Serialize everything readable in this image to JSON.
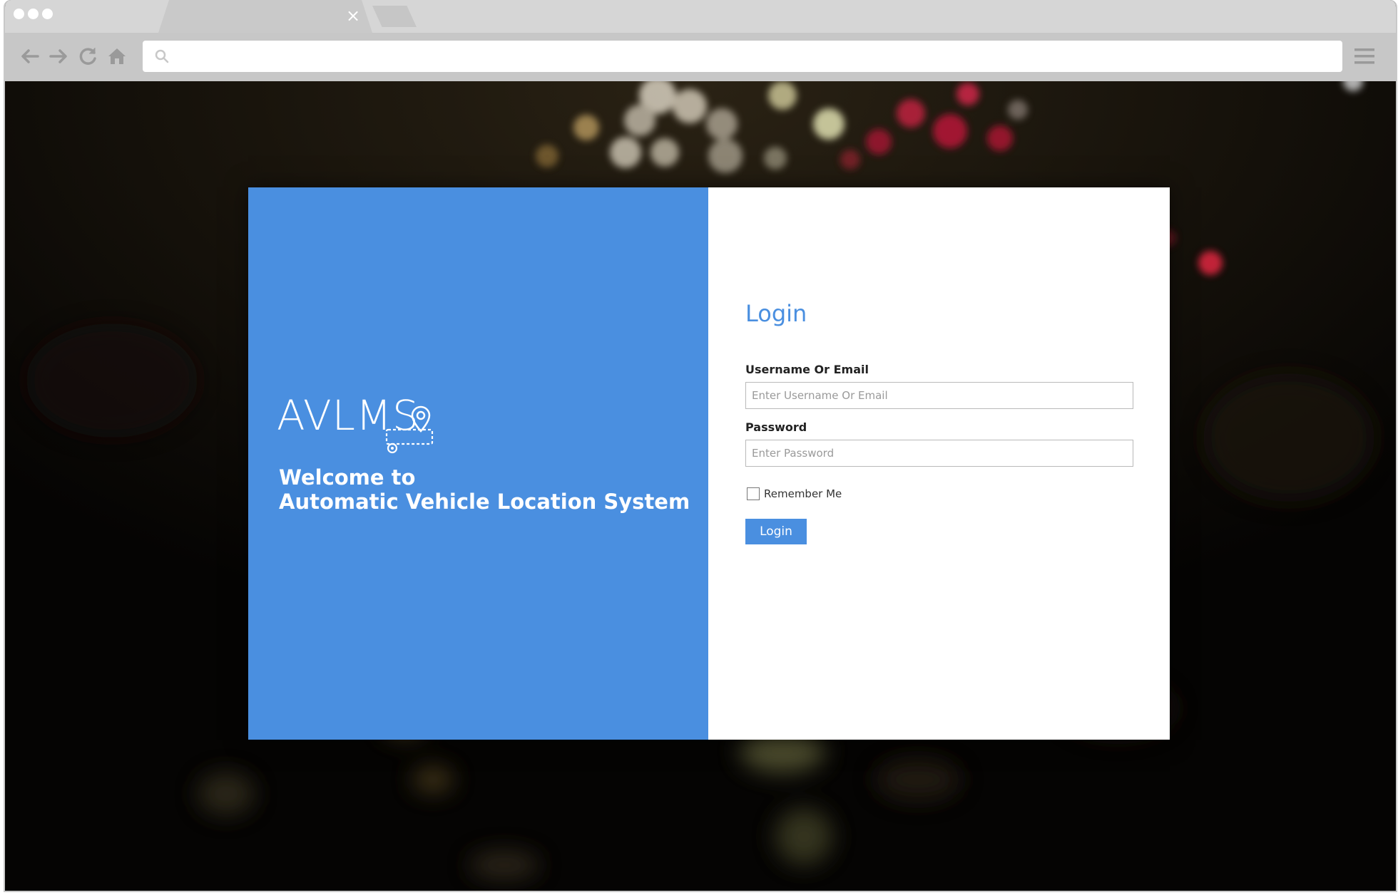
{
  "browser": {
    "tab_close_glyph": "×",
    "address": {
      "value": "",
      "placeholder": ""
    },
    "icons": [
      "back-arrow-icon",
      "forward-arrow-icon",
      "reload-icon",
      "home-icon",
      "search-icon",
      "hamburger-menu-icon"
    ]
  },
  "brand": {
    "logo_text": "AVLMS",
    "welcome_line1": "Welcome to",
    "welcome_line2": "Automatic Vehicle Location System",
    "accent_color": "#4a8fe0"
  },
  "login": {
    "title": "Login",
    "username_label": "Username Or Email",
    "username_placeholder": "Enter Username Or Email",
    "password_label": "Password",
    "password_placeholder": "Enter Password",
    "remember_label": "Remember Me",
    "remember_checked": false,
    "submit_label": "Login"
  }
}
